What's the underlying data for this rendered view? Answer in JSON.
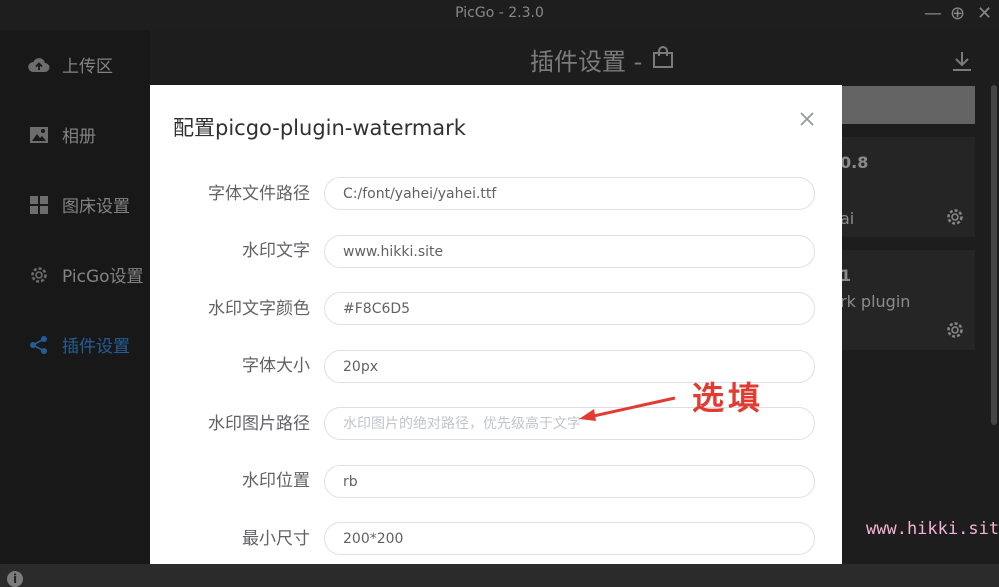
{
  "window": {
    "title": "PicGo - 2.3.0",
    "controls": {
      "minimize_glyph": "—",
      "maximize_glyph": "⊕",
      "close_glyph": "✕"
    }
  },
  "sidebar": {
    "items": [
      {
        "label": "上传区",
        "icon": "cloud-upload-icon",
        "active": false
      },
      {
        "label": "相册",
        "icon": "image-icon",
        "active": false
      },
      {
        "label": "图床设置",
        "icon": "grid-icon",
        "active": false
      },
      {
        "label": "PicGo设置",
        "icon": "gear-icon",
        "active": false
      },
      {
        "label": "插件设置",
        "icon": "share-icon",
        "active": true
      }
    ],
    "info_glyph": "i"
  },
  "main": {
    "title": "插件设置 -",
    "cards": [
      {
        "version_fragment": "0.8",
        "author_fragment": "ai"
      },
      {
        "version_fragment": "1",
        "desc_fragment": "rk plugin"
      }
    ]
  },
  "dialog": {
    "title": "配置picgo-plugin-watermark",
    "fields": [
      {
        "label": "字体文件路径",
        "value": "C:/font/yahei/yahei.ttf",
        "placeholder": ""
      },
      {
        "label": "水印文字",
        "value": "www.hikki.site",
        "placeholder": ""
      },
      {
        "label": "水印文字颜色",
        "value": "#F8C6D5",
        "placeholder": ""
      },
      {
        "label": "字体大小",
        "value": "20px",
        "placeholder": ""
      },
      {
        "label": "水印图片路径",
        "value": "",
        "placeholder": "水印图片的绝对路径，优先级高于文字"
      },
      {
        "label": "水印位置",
        "value": "rb",
        "placeholder": ""
      },
      {
        "label": "最小尺寸",
        "value": "200*200",
        "placeholder": ""
      }
    ]
  },
  "annotation": {
    "text": "选填",
    "color": "#e23b32"
  },
  "watermark": {
    "text": "www.hikki.site",
    "color": "#f4b3d6"
  },
  "colors": {
    "accent": "#3a8ee6",
    "sidebar_bg": "#262626",
    "main_bg": "#2d2d2d"
  }
}
